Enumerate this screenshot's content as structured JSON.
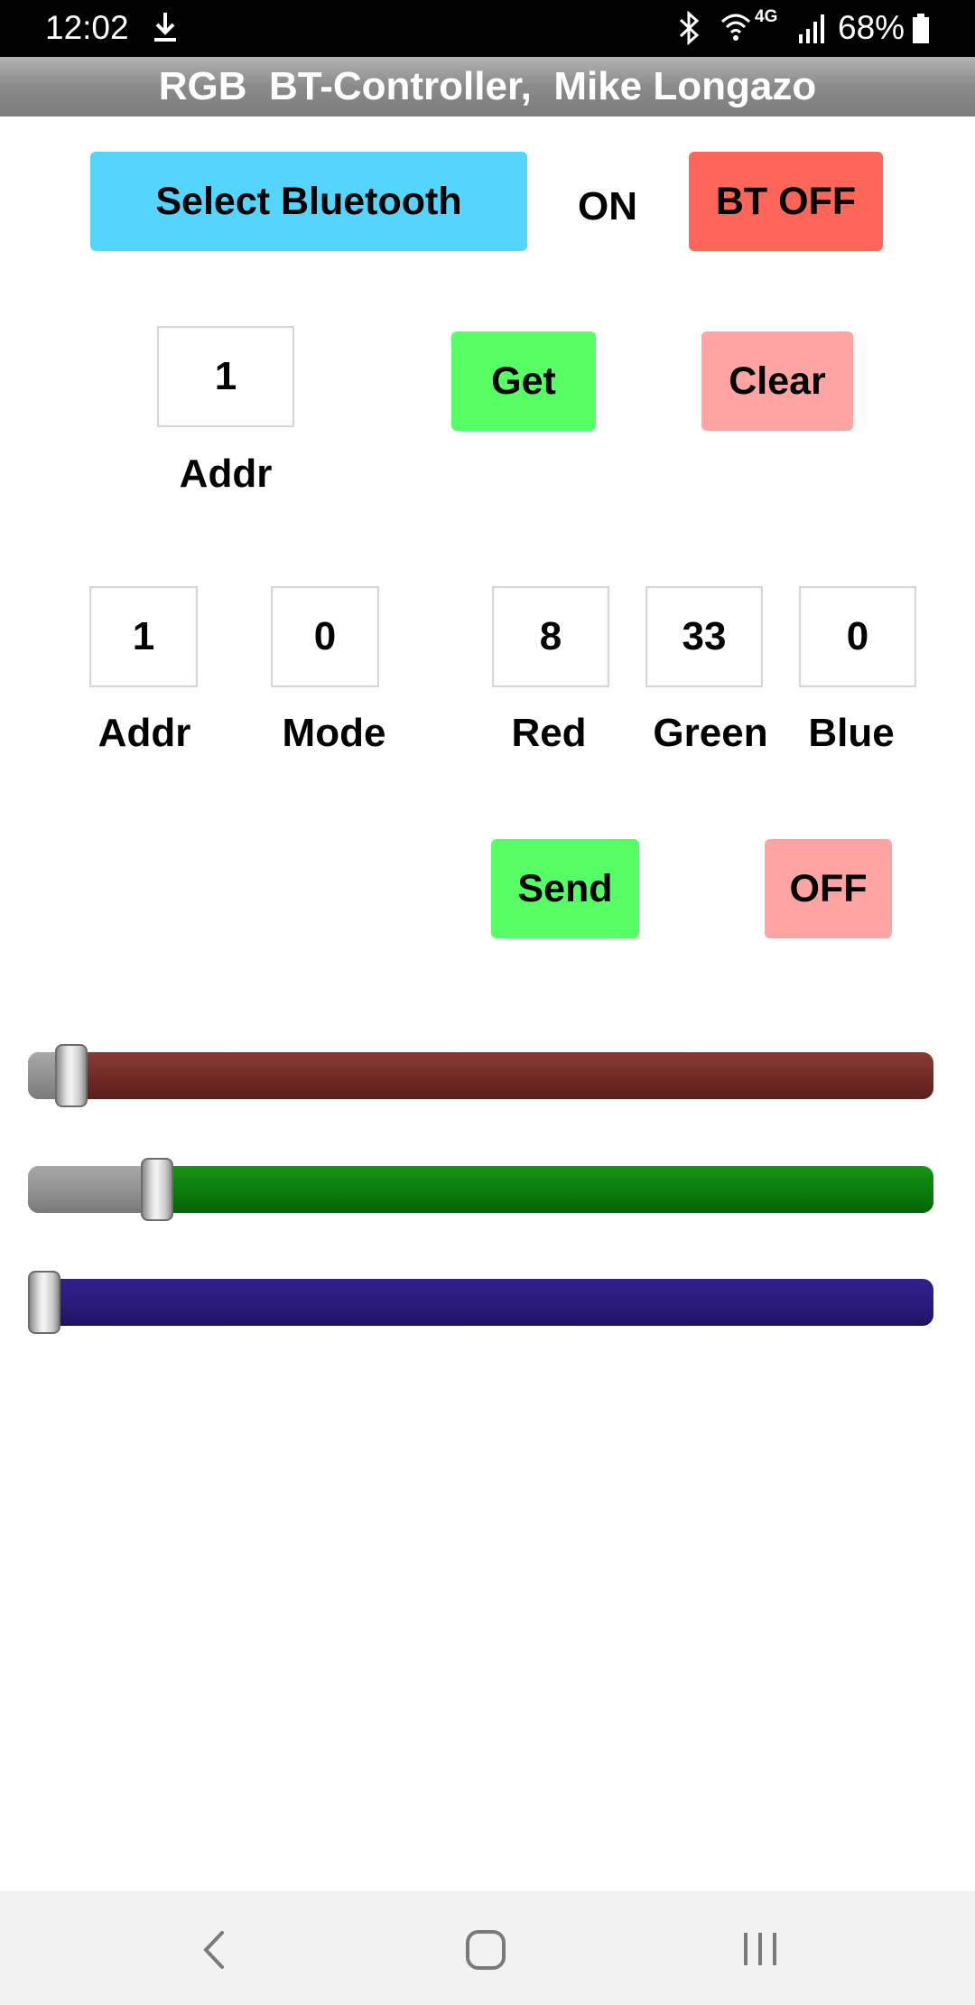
{
  "status_bar": {
    "time": "12:02",
    "network": "4G",
    "battery": "68%",
    "icons": [
      "download-icon",
      "bluetooth-icon",
      "wifi-icon",
      "signal-icon",
      "battery-icon"
    ]
  },
  "title": "RGB  BT-Controller,  Mike Longazo",
  "bluetooth": {
    "select_label": "Select Bluetooth",
    "state": "ON",
    "off_label": "BT OFF"
  },
  "get_section": {
    "addr_value": "1",
    "addr_label": "Addr",
    "get_label": "Get",
    "clear_label": "Clear"
  },
  "send_section": {
    "fields": [
      {
        "value": "1",
        "label": "Addr"
      },
      {
        "value": "0",
        "label": "Mode"
      },
      {
        "value": "8",
        "label": "Red"
      },
      {
        "value": "33",
        "label": "Green"
      },
      {
        "value": "0",
        "label": "Blue"
      }
    ],
    "send_label": "Send",
    "off_label": "OFF"
  },
  "sliders": {
    "red": {
      "value": 8,
      "max": 255
    },
    "green": {
      "value": 33,
      "max": 255
    },
    "blue": {
      "value": 0,
      "max": 255
    }
  },
  "colors": {
    "select_bt": "#55d4fd",
    "bt_off": "#ff6659",
    "get": "#57ff67",
    "clear": "#fea4a3",
    "send": "#57ff67",
    "off": "#fea4a3",
    "red_track": "#7a2f2a",
    "green_track": "#0a7a0a",
    "blue_track": "#2a1a7a"
  },
  "nav_bar": {
    "icons": [
      "back-icon",
      "home-icon",
      "recent-apps-icon"
    ]
  }
}
